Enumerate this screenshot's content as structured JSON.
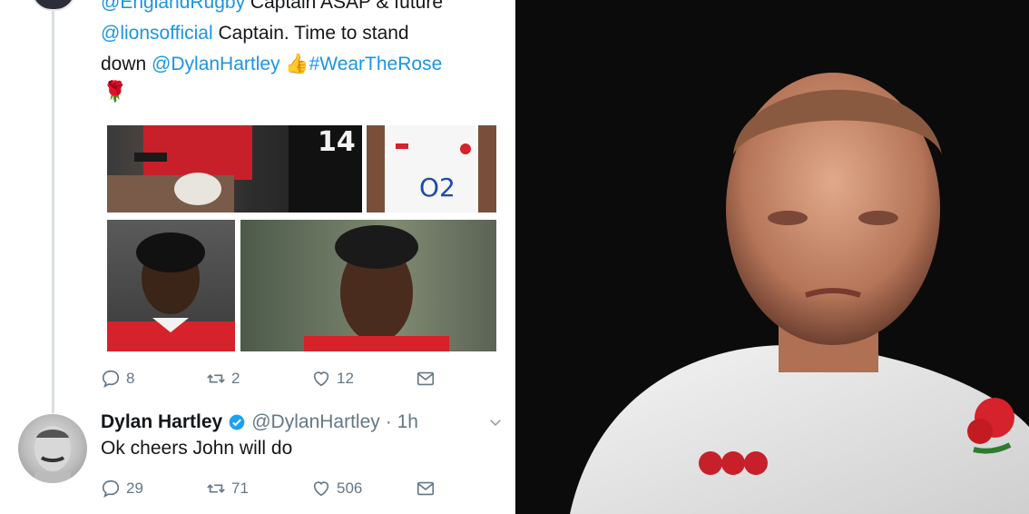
{
  "tweet": {
    "line1_prefix_link": "@EnglandRugby",
    "line1_text": " Captain ASAP & future",
    "line2_link": "@lionsofficial",
    "line2_text": " Captain. Time to stand",
    "line3_text": "down ",
    "line3_mention": "@DylanHartley",
    "line3_emoji": "👍",
    "line3_hashtag": "#WearTheRose",
    "rose_emoji": "🌹",
    "media_texts": {
      "jersey_number": "14",
      "sponsor": "O2"
    },
    "actions": {
      "replies": "8",
      "retweets": "2",
      "likes": "12"
    }
  },
  "reply": {
    "name": "Dylan Hartley",
    "handle": "@DylanHartley",
    "time": "· 1h",
    "text": "Ok cheers John will do",
    "actions": {
      "replies": "29",
      "retweets": "71",
      "likes": "506"
    }
  },
  "colors": {
    "link": "#1b95e0",
    "muted": "#657786",
    "verified": "#1da1f2",
    "red_jersey": "#d6222a"
  }
}
